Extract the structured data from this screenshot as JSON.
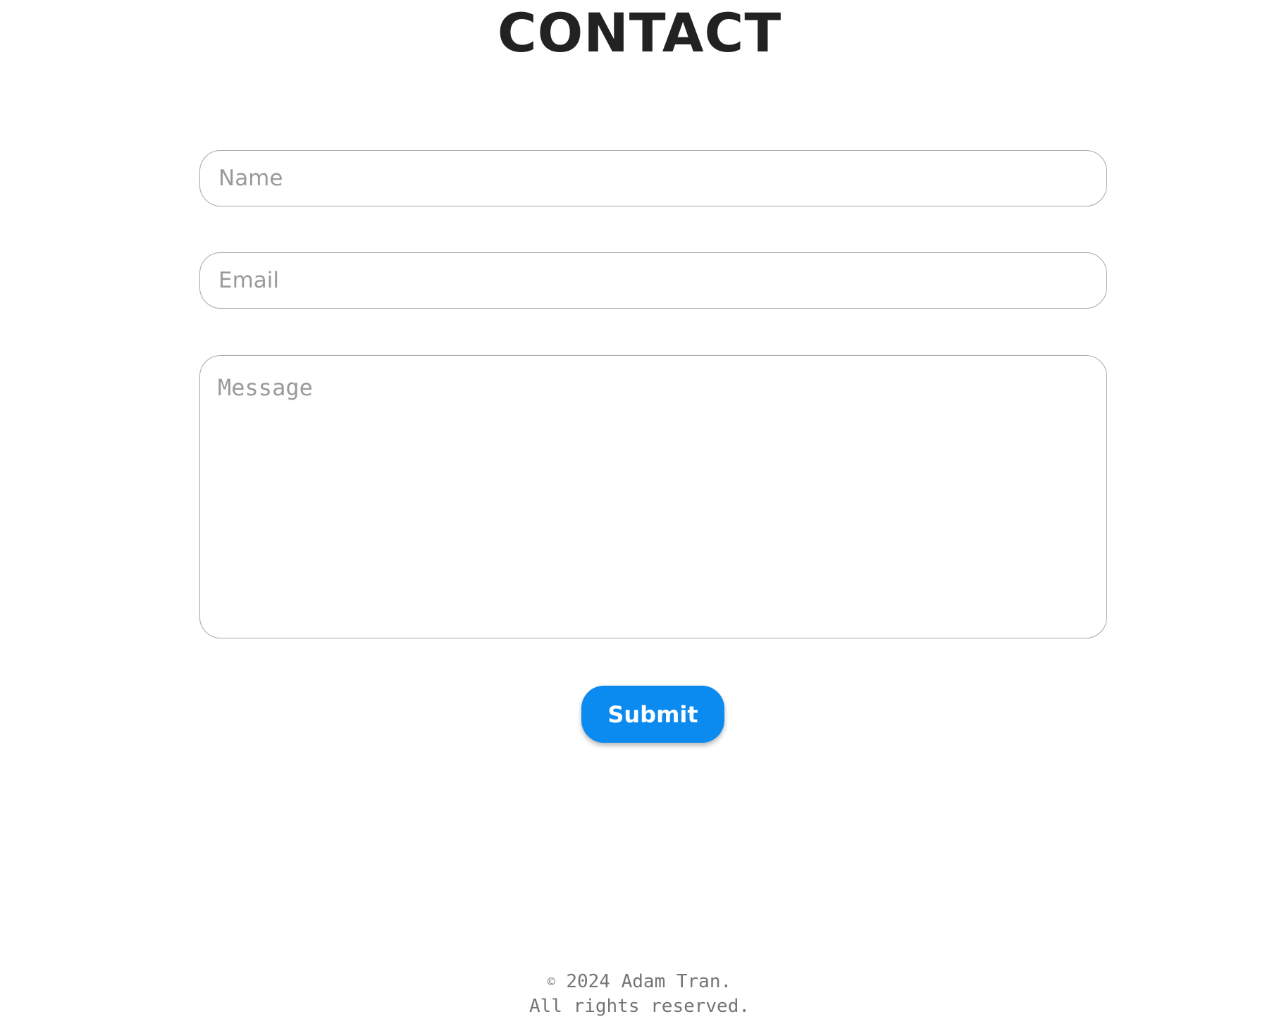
{
  "header": {
    "title": "CONTACT"
  },
  "form": {
    "name_placeholder": "Name",
    "email_placeholder": "Email",
    "message_placeholder": "Message",
    "submit_label": "Submit"
  },
  "footer": {
    "copyright_symbol": "©",
    "copyright_text": "2024 Adam Tran.",
    "rights_text": "All rights reserved."
  },
  "colors": {
    "accent": "#0b8af0",
    "title": "#222222",
    "placeholder": "#9a9a9a",
    "border": "#a8a8a8",
    "footer_text": "#757575"
  }
}
